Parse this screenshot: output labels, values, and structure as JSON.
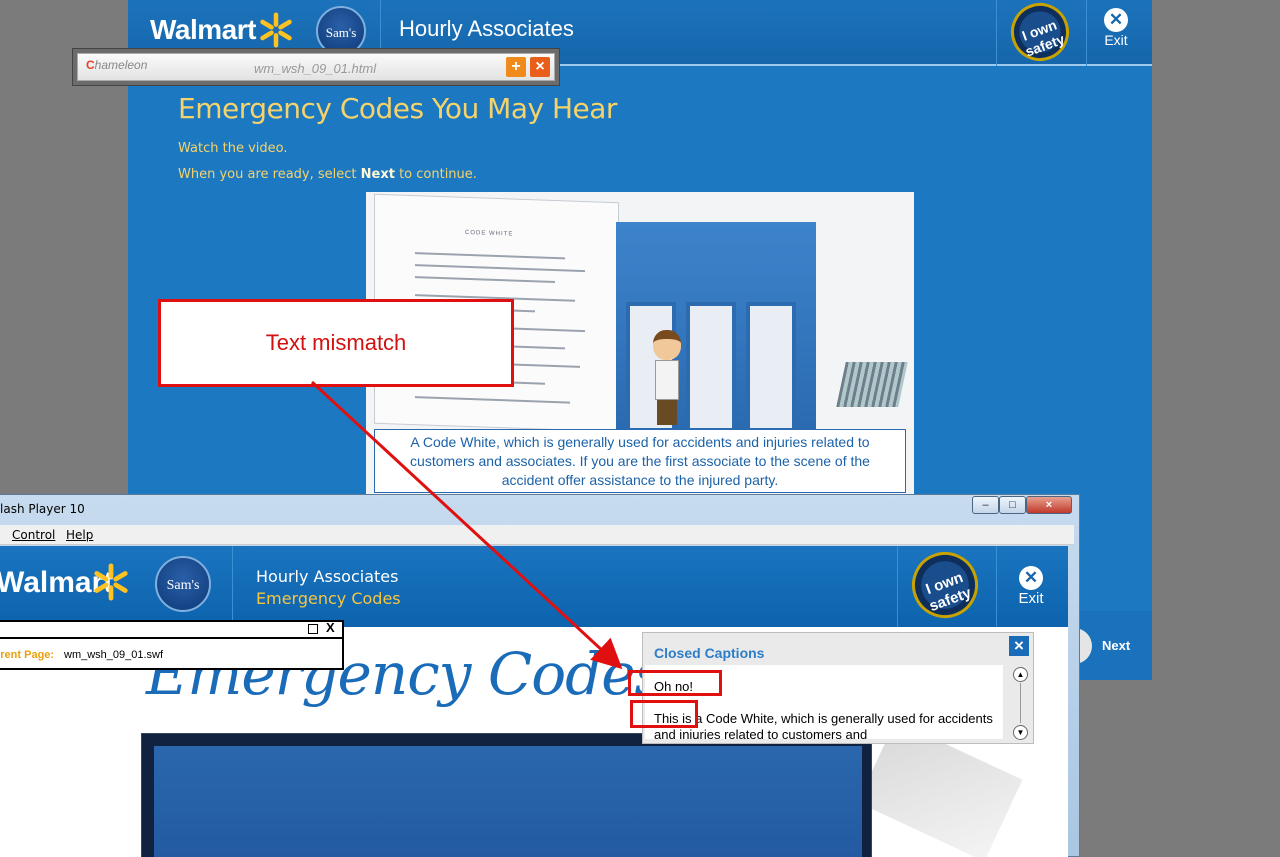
{
  "bg_course": {
    "brand": "Walmart",
    "sams": "Sam's",
    "header_title": "Hourly Associates",
    "safety_badge": "I own safety",
    "exit_label": "Exit",
    "heading": "Emergency Codes You May Hear",
    "instruction1": "Watch the video.",
    "instruction2_pre": "When you are ready, select ",
    "instruction2_bold": "Next",
    "instruction2_post": " to continue.",
    "video_caption": "A Code White, which is generally used for accidents and injuries related to customers and associates.  If you are the first associate to the scene of the accident offer assistance to the injured party.",
    "next_label": "Next"
  },
  "chameleon": {
    "logo": "hameleon",
    "logo_c": "C",
    "filename": "wm_wsh_09_01.html",
    "plus": "+",
    "close": "×"
  },
  "flash_window": {
    "title": "lash Player 10",
    "btn_min": "–",
    "btn_max": "□",
    "btn_close": "×",
    "menu": [
      "Control",
      "Help"
    ],
    "brand": "Walmart",
    "sams": "Sam's",
    "hourly": "Hourly Associates",
    "subtitle": "Emergency Codes",
    "safety_badge": "I own safety",
    "exit_label": "Exit",
    "heading": "Emergency Codes"
  },
  "status_panel": {
    "close": "X",
    "label": "rrent Page:",
    "value": "wm_wsh_09_01.swf"
  },
  "closed_captions": {
    "title": "Closed Captions",
    "close": "×",
    "line1": "Oh no!",
    "line2": "This is a Code White, which is generally used for accidents and injuries related to customers and"
  },
  "annotation": {
    "callout": "Text mismatch"
  },
  "colors": {
    "walmart_blue": "#1d78c2",
    "heading_yellow": "#f5d36b",
    "annotation_red": "#e01010"
  }
}
